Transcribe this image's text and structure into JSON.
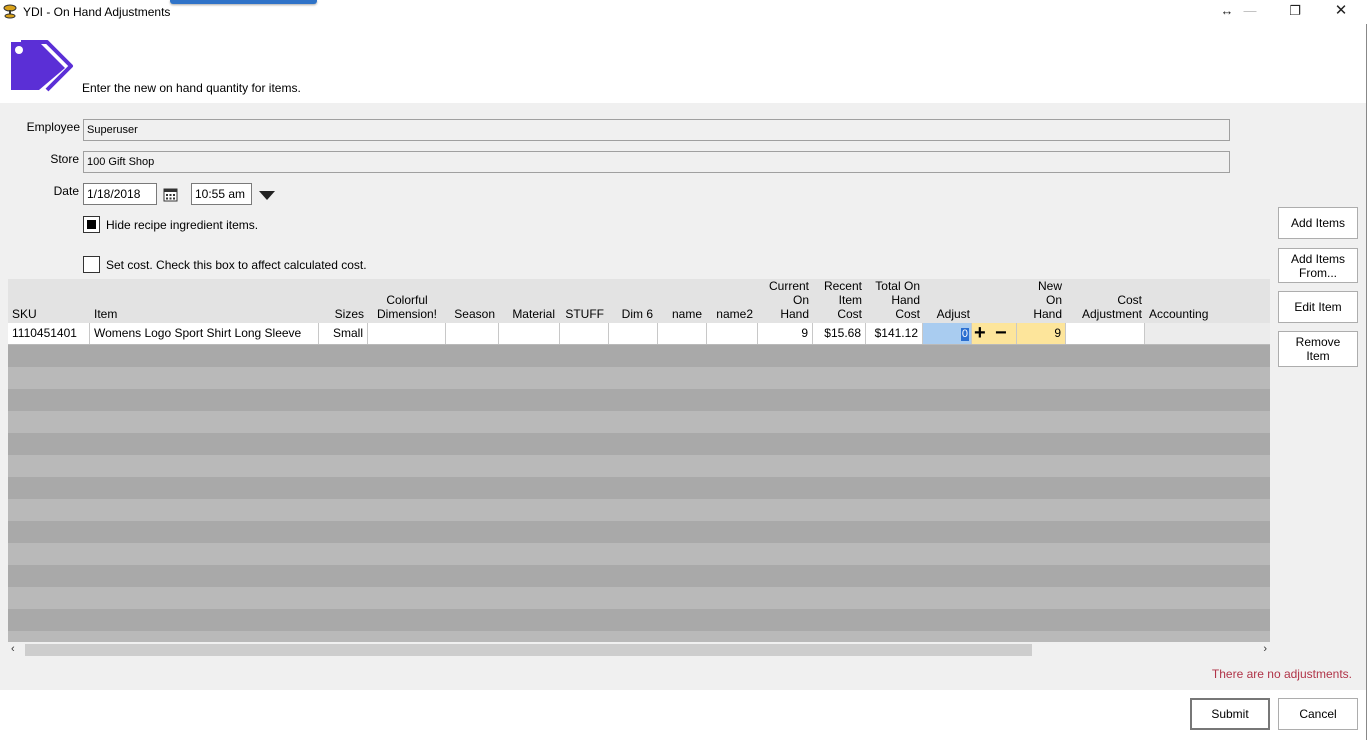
{
  "window": {
    "title": "YDI - On Hand Adjustments",
    "controls": {
      "move": "↔",
      "minimize": "—",
      "restore": "❐",
      "close": "✕"
    }
  },
  "header": {
    "instruction": "Enter the new on hand quantity for items.",
    "icon": "price-tags-icon"
  },
  "form": {
    "employee_label": "Employee",
    "employee_value": "Superuser",
    "store_label": "Store",
    "store_value": "100 Gift Shop",
    "date_label": "Date",
    "date_value": "1/18/2018",
    "time_value": "10:55 am",
    "hide_recipe_label": "Hide recipe ingredient items.",
    "hide_recipe_checked": true,
    "set_cost_label": "Set cost. Check this box to affect calculated cost.",
    "set_cost_checked": false
  },
  "side_buttons": {
    "add_items": "Add Items",
    "add_items_from_1": "Add Items",
    "add_items_from_2": "From...",
    "edit_item": "Edit Item",
    "remove_item_1": "Remove",
    "remove_item_2": "Item"
  },
  "grid": {
    "columns": {
      "sku": "SKU",
      "item": "Item",
      "sizes": "Sizes",
      "colorful_1": "Colorful",
      "colorful_2": "Dimension!",
      "season": "Season",
      "material": "Material",
      "stuff": "STUFF",
      "dim6": "Dim 6",
      "name": "name",
      "name2": "name2",
      "current_1": "Current",
      "current_2": "On",
      "current_3": "Hand",
      "recent_1": "Recent",
      "recent_2": "Item",
      "recent_3": "Cost",
      "total_1": "Total On",
      "total_2": "Hand",
      "total_3": "Cost",
      "adjust": "Adjust",
      "new_1": "New",
      "new_2": "On",
      "new_3": "Hand",
      "costadj_1": "Cost",
      "costadj_2": "Adjustment",
      "accounting": "Accounting"
    },
    "rows": [
      {
        "sku": "1110451401",
        "item": "Womens Logo Sport Shirt Long Sleeve",
        "sizes": "Small",
        "colorful": "",
        "season": "",
        "material": "",
        "stuff": "",
        "dim6": "",
        "name": "",
        "name2": "",
        "current_on_hand": "9",
        "recent_item_cost": "$15.68",
        "total_on_hand_cost": "$141.12",
        "adjust": "0",
        "plus": "+",
        "minus": "−",
        "new_on_hand": "9",
        "cost_adjustment": "",
        "accounting": ""
      }
    ]
  },
  "scrollbar": {
    "left": "‹",
    "right": "›"
  },
  "status_message": "There are no adjustments.",
  "footer": {
    "submit": "Submit",
    "cancel": "Cancel"
  },
  "colors": {
    "accent_icon": "#5b2fd6",
    "status": "#b03448",
    "adjust_cell": "#a9ccf0",
    "new_on_hand_cell": "#fde59b"
  }
}
